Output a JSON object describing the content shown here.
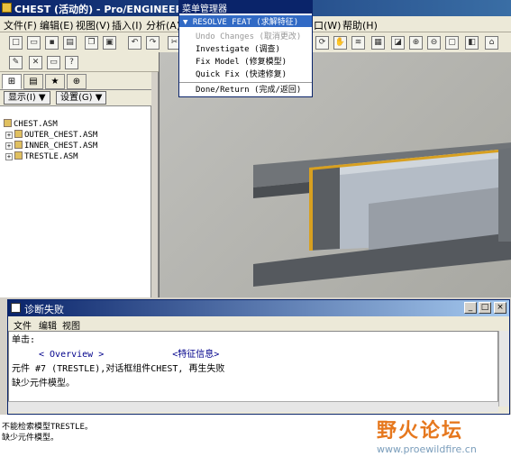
{
  "window": {
    "title": "CHEST (活动的) - Pro/ENGINEER"
  },
  "menubar": {
    "items": [
      "文件(F)",
      "编辑(E)",
      "视图(V)",
      "插入(I)",
      "分析(A)",
      "口(W)",
      "帮助(H)"
    ]
  },
  "left_panel": {
    "show_button": "显示(I) ▼",
    "settings_button": "设置(G) ▼",
    "tree": [
      {
        "label": "CHEST.ASM",
        "expandable": false
      },
      {
        "label": "OUTER_CHEST.ASM",
        "expandable": true
      },
      {
        "label": "INNER_CHEST.ASM",
        "expandable": true
      },
      {
        "label": "TRESTLE.ASM",
        "expandable": true
      }
    ]
  },
  "menu_manager": {
    "title": "菜单管理器",
    "items": [
      {
        "label": "▼ RESOLVE FEAT (求解特征)",
        "state": "selected"
      },
      {
        "label": "Undo Changes (取消更改)",
        "state": "disabled"
      },
      {
        "label": "Investigate (调查)",
        "state": "normal"
      },
      {
        "label": "Fix Model (修复模型)",
        "state": "normal"
      },
      {
        "label": "Quick Fix (快速修复)",
        "state": "normal"
      },
      {
        "label": "Done/Return (完成/返回)",
        "state": "normal"
      }
    ]
  },
  "diagnostic": {
    "title": "诊断失败",
    "menu": [
      "文件",
      "编辑",
      "视图"
    ],
    "line1": "单击:",
    "overview": "< Overview >",
    "feature_info": "<特征信息>",
    "line3": "元件 #7 (TRESTLE),对话框组件CHEST, 再生失败",
    "line4": "缺少元件模型。"
  },
  "status": {
    "line1": "不能检索模型TRESTLE。",
    "line2": "缺少元件模型。"
  },
  "watermark": {
    "text": "野火论坛",
    "url": "www.proewildfire.cn"
  }
}
